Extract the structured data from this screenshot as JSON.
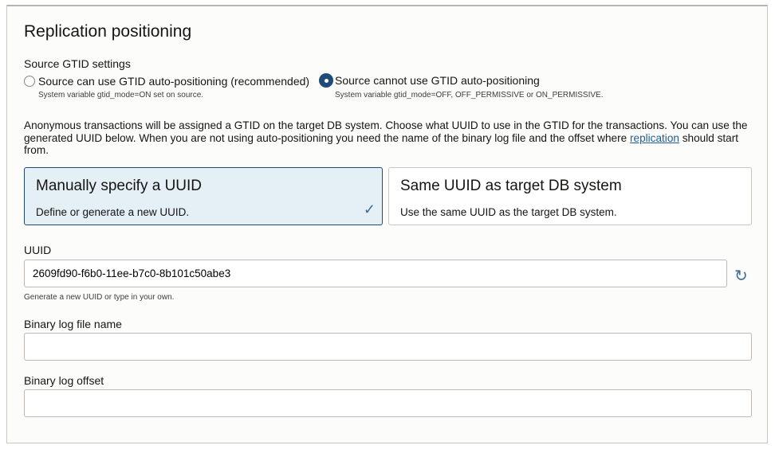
{
  "title": "Replication positioning",
  "gtid": {
    "label": "Source GTID settings",
    "options": [
      {
        "label": "Source can use GTID auto-positioning (recommended)",
        "hint": "System variable gtid_mode=ON set on source.",
        "selected": false
      },
      {
        "label": "Source cannot use GTID auto-positioning",
        "hint": "System variable gtid_mode=OFF, OFF_PERMISSIVE or ON_PERMISSIVE.",
        "selected": true
      }
    ]
  },
  "description": "Anonymous transactions will be assigned a GTID on the target DB system. Choose what UUID to use in the GTID for the transactions. You can use the generated UUID below. When you are not using auto-positioning you need the name of the binary log file and the offset where ",
  "description_link": "replication",
  "description_end": " should start from.",
  "cards": [
    {
      "title": "Manually specify a UUID",
      "desc": "Define or generate a new UUID.",
      "selected": true
    },
    {
      "title": "Same UUID as target DB system",
      "desc": "Use the same UUID as the target DB system.",
      "selected": false
    }
  ],
  "uuid": {
    "label": "UUID",
    "value": "2609fd90-f6b0-11ee-b7c0-8b101c50abe3",
    "hint": "Generate a new UUID or type in your own."
  },
  "binlog_file": {
    "label": "Binary log file name",
    "value": ""
  },
  "binlog_offset": {
    "label": "Binary log offset",
    "value": ""
  }
}
